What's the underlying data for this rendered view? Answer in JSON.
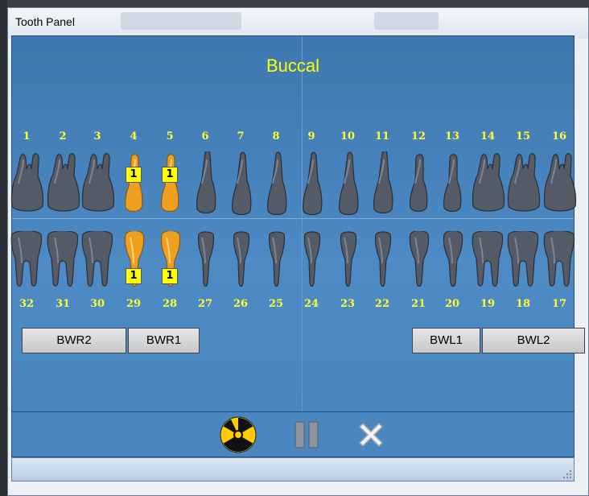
{
  "window": {
    "title": "Tooth Panel"
  },
  "panel": {
    "heading": "Buccal"
  },
  "upper_numbers": [
    "1",
    "2",
    "3",
    "4",
    "5",
    "6",
    "7",
    "8",
    "9",
    "10",
    "11",
    "12",
    "13",
    "14",
    "15",
    "16"
  ],
  "lower_numbers": [
    "32",
    "31",
    "30",
    "29",
    "28",
    "27",
    "26",
    "25",
    "24",
    "23",
    "22",
    "21",
    "20",
    "19",
    "18",
    "17"
  ],
  "selected_teeth": [
    "4",
    "5",
    "29",
    "28"
  ],
  "selected_badge": "1",
  "colors": {
    "tooth": "#545b66",
    "selected": "#f0a020",
    "label": "#ffff33"
  },
  "bitewing_buttons": {
    "bwr2": "BWR2",
    "bwr1": "BWR1",
    "bwl1": "BWL1",
    "bwl2": "BWL2"
  },
  "toolbar": {
    "xray_icon": "radiation-icon",
    "pause_icon": "pause-icon",
    "close_icon": "close-x-icon"
  }
}
